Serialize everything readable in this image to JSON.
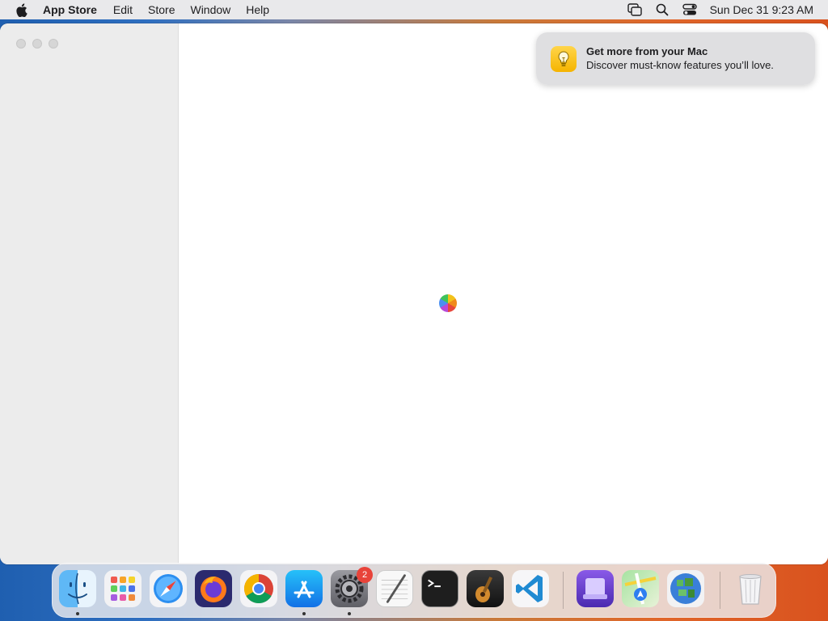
{
  "menubar": {
    "app_name": "App Store",
    "items": [
      "Edit",
      "Store",
      "Window",
      "Help"
    ],
    "clock": "Sun Dec 31  9:23 AM",
    "status_icons": [
      "screen-mirroring-icon",
      "spotlight-search-icon",
      "control-center-icon"
    ]
  },
  "notification": {
    "title": "Get more from your Mac",
    "body": "Discover must-know features you’ll love.",
    "icon": "lightbulb-icon"
  },
  "window": {
    "state": "loading",
    "spinner": "loading-spinner-icon"
  },
  "dock": {
    "items": [
      {
        "name": "finder",
        "running": true
      },
      {
        "name": "launchpad",
        "running": false
      },
      {
        "name": "safari",
        "running": false
      },
      {
        "name": "firefox",
        "running": false
      },
      {
        "name": "chrome",
        "running": false
      },
      {
        "name": "app-store",
        "running": true
      },
      {
        "name": "system-settings",
        "running": true,
        "badge": "2"
      },
      {
        "name": "textedit",
        "running": false
      },
      {
        "name": "terminal",
        "running": false
      },
      {
        "name": "garageband",
        "running": false
      },
      {
        "name": "vscode",
        "running": false
      },
      {
        "name": "simulator",
        "running": false
      },
      {
        "name": "maps",
        "running": false
      },
      {
        "name": "minecraft",
        "running": false
      },
      {
        "name": "trash",
        "running": false
      }
    ]
  },
  "colors": {
    "accent_notification_icon": "#f5b400",
    "badge": "#e8433a"
  }
}
